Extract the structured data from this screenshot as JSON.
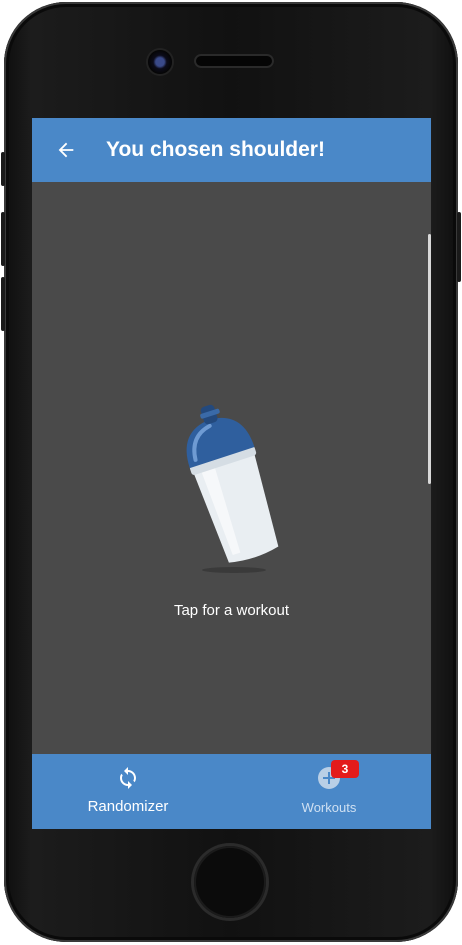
{
  "header": {
    "title": "You chosen shoulder!"
  },
  "main": {
    "tap_label": "Tap for a workout"
  },
  "bottom_nav": {
    "items": [
      {
        "label": "Randomizer",
        "icon": "refresh-icon",
        "active": true
      },
      {
        "label": "Workouts",
        "icon": "add-circle-icon",
        "active": false,
        "badge": "3"
      }
    ]
  },
  "colors": {
    "app_bar": "#4a88c8",
    "content_bg": "#4a4a4a",
    "badge": "#e31b1b"
  }
}
